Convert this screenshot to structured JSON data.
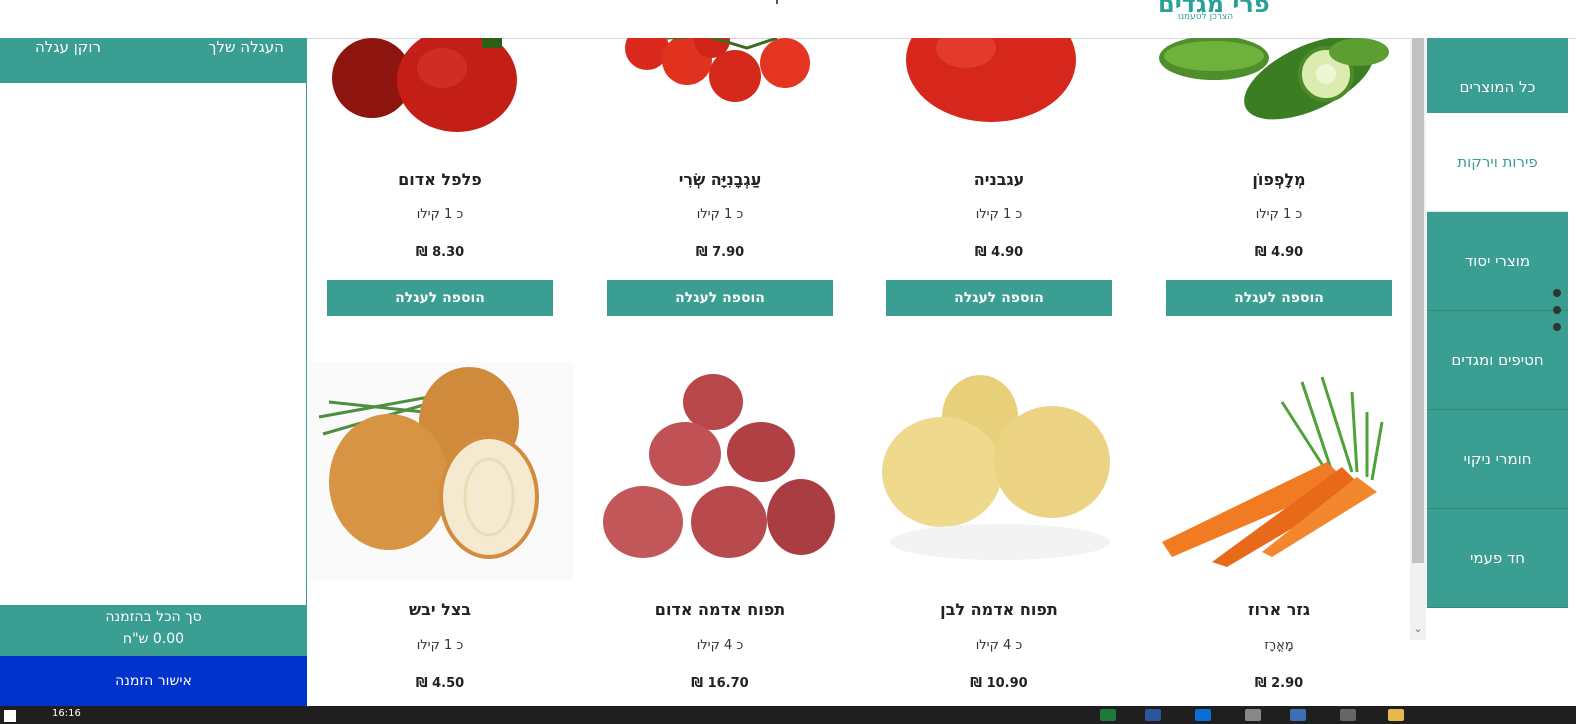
{
  "header": {
    "logo_main": "פרי מגדים",
    "logo_sub": "הצרכן לטעמנו"
  },
  "categories": [
    {
      "label": "כל המוצרים"
    },
    {
      "label": "פירות וירקות"
    },
    {
      "label": "מוצרי יסוד"
    },
    {
      "label": "חטיפים ומגדים"
    },
    {
      "label": "חומרי ניקוי"
    },
    {
      "label": "חד פעמי"
    }
  ],
  "cart": {
    "title": "העגלה שלך",
    "empty": "רוקן עגלה",
    "total_label": "סך הכל בהזמנה",
    "total_value": "0.00 ש\"ח",
    "confirm": "אישור הזמנה"
  },
  "products": [
    {
      "name": "מְלָפְפוֹן",
      "unit": "כ 1 קילו",
      "price": "4.90 ₪",
      "button": "הוספה לעגלה",
      "image": "cucumber"
    },
    {
      "name": "עגבניה",
      "unit": "כ 1 קילו",
      "price": "4.90 ₪",
      "button": "הוספה לעגלה",
      "image": "tomato"
    },
    {
      "name": "עַגְבָנִיָּה שְׂרִי",
      "unit": "כ 1 קילו",
      "price": "7.90 ₪",
      "button": "הוספה לעגלה",
      "image": "cherry-tomatoes"
    },
    {
      "name": "פלפל אדום",
      "unit": "כ 1 קילו",
      "price": "8.30 ₪",
      "button": "הוספה לעגלה",
      "image": "red-pepper"
    },
    {
      "name": "גזר ארוז",
      "unit": "מָאֳרָז",
      "price": "2.90 ₪",
      "image": "carrots"
    },
    {
      "name": "תפוח אדמה לבן",
      "unit": "כ 4 קילו",
      "price": "10.90 ₪",
      "image": "white-potatoes"
    },
    {
      "name": "תפוח אדמה אדום",
      "unit": "כ 4 קילו",
      "price": "16.70 ₪",
      "image": "red-potatoes"
    },
    {
      "name": "בצל יבש",
      "unit": "כ 1 קילו",
      "price": "4.50 ₪",
      "image": "onions"
    }
  ],
  "taskbar": {
    "time": "16:16"
  },
  "colors": {
    "primary": "#3a9e92",
    "confirm": "#0033cc"
  }
}
